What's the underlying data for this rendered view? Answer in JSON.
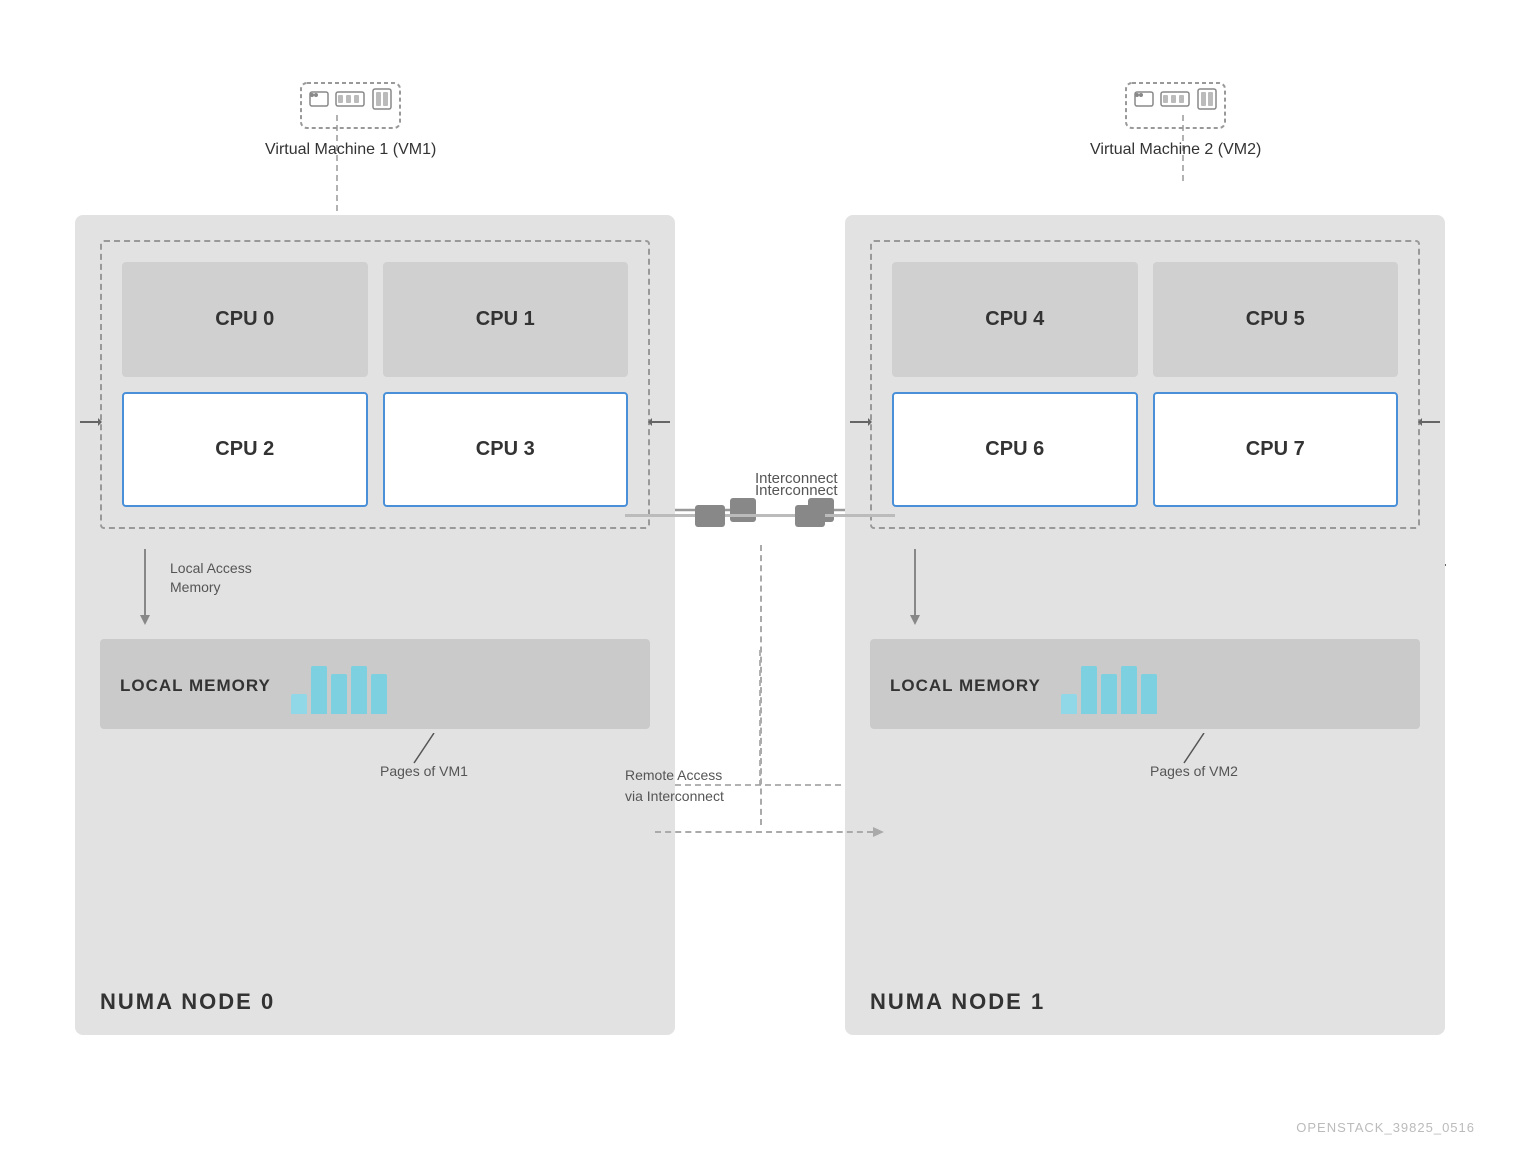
{
  "vm1": {
    "label": "Virtual Machine 1 (VM1)"
  },
  "vm2": {
    "label": "Virtual Machine 2 (VM2)"
  },
  "node0": {
    "label": "NUMA NODE 0",
    "cpus": [
      "CPU 0",
      "CPU 1",
      "CPU 2",
      "CPU 3"
    ],
    "highlighted_cpus": [
      2,
      3
    ],
    "memory_label": "LOCAL MEMORY",
    "pages_label": "Pages of VM1"
  },
  "node1": {
    "label": "NUMA NODE 1",
    "cpus": [
      "CPU 4",
      "CPU 5",
      "CPU 6",
      "CPU 7"
    ],
    "highlighted_cpus": [
      2,
      3
    ],
    "memory_label": "LOCAL MEMORY",
    "pages_label": "Pages of VM2"
  },
  "interconnect_label": "Interconnect",
  "local_access_label": "Local Access\nMemory",
  "remote_access_label": "Remote Access\nvia Interconnect",
  "watermark": "OPENSTACK_39825_0516"
}
